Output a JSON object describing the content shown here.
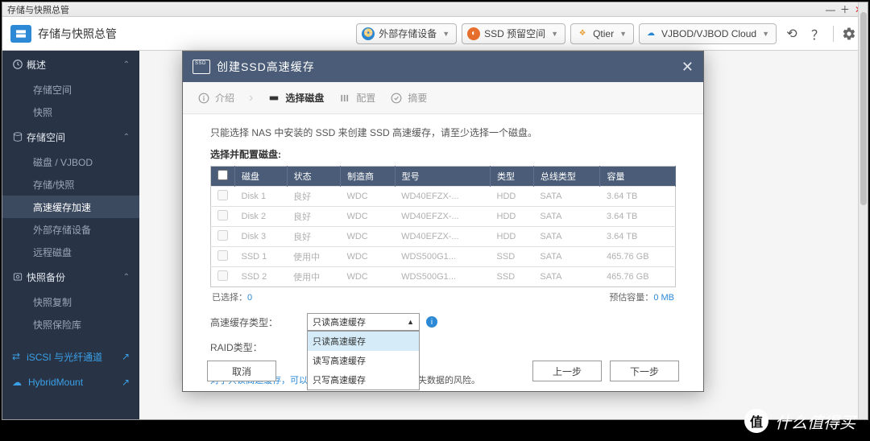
{
  "titlebar": {
    "title": "存储与快照总管"
  },
  "toolbar": {
    "title": "存储与快照总管",
    "pills": [
      {
        "label": "外部存储设备"
      },
      {
        "label": "SSD 预留空间"
      },
      {
        "label": "Qtier"
      },
      {
        "label": "VJBOD/VJBOD Cloud"
      }
    ]
  },
  "sidebar": {
    "groups": [
      {
        "label": "概述",
        "items": [
          "存储空间",
          "快照"
        ]
      },
      {
        "label": "存储空间",
        "items": [
          "磁盘 / VJBOD",
          "存储/快照",
          "高速缓存加速",
          "外部存储设备",
          "远程磁盘"
        ],
        "active_index": 2
      },
      {
        "label": "快照备份",
        "items": [
          "快照复制",
          "快照保险库"
        ]
      }
    ],
    "links": [
      {
        "label": "iSCSI 与光纤通道"
      },
      {
        "label": "HybridMount"
      }
    ]
  },
  "modal": {
    "title": "创建SSD高速缓存",
    "steps": [
      "介绍",
      "选择磁盘",
      "配置",
      "摘要"
    ],
    "active_step": 1,
    "instruction": "只能选择 NAS 中安装的 SSD 来创建 SSD 高速缓存，请至少选择一个磁盘。",
    "select_label": "选择并配置磁盘:",
    "columns": [
      "磁盘",
      "状态",
      "制造商",
      "型号",
      "类型",
      "总线类型",
      "容量"
    ],
    "rows": [
      {
        "disk": "Disk 1",
        "status": "良好",
        "vendor": "WDC",
        "model": "WD40EFZX-...",
        "type": "HDD",
        "bus": "SATA",
        "cap": "3.64 TB"
      },
      {
        "disk": "Disk 2",
        "status": "良好",
        "vendor": "WDC",
        "model": "WD40EFZX-...",
        "type": "HDD",
        "bus": "SATA",
        "cap": "3.64 TB"
      },
      {
        "disk": "Disk 3",
        "status": "良好",
        "vendor": "WDC",
        "model": "WD40EFZX-...",
        "type": "HDD",
        "bus": "SATA",
        "cap": "3.64 TB"
      },
      {
        "disk": "SSD 1",
        "status": "使用中",
        "vendor": "WDC",
        "model": "WDS500G1...",
        "type": "SSD",
        "bus": "SATA",
        "cap": "465.76 GB"
      },
      {
        "disk": "SSD 2",
        "status": "使用中",
        "vendor": "WDC",
        "model": "WDS500G1...",
        "type": "SSD",
        "bus": "SATA",
        "cap": "465.76 GB"
      }
    ],
    "selected_label": "已选择：",
    "selected_count": "0",
    "est_label": "预估容量：",
    "est_value": "0 MB",
    "cache_type_label": "高速缓存类型：",
    "raid_type_label": "RAID类型：",
    "cache_type_selected": "只读高速缓存",
    "cache_type_options": [
      "只读高速缓存",
      "读写高速缓存",
      "只写高速缓存"
    ],
    "note_link": "对于只读高速缓存，可以使用",
    "note_tail": "丢失数据的风险。",
    "buttons": {
      "cancel": "取消",
      "prev": "上一步",
      "next": "下一步"
    }
  },
  "watermark": "什么值得买"
}
